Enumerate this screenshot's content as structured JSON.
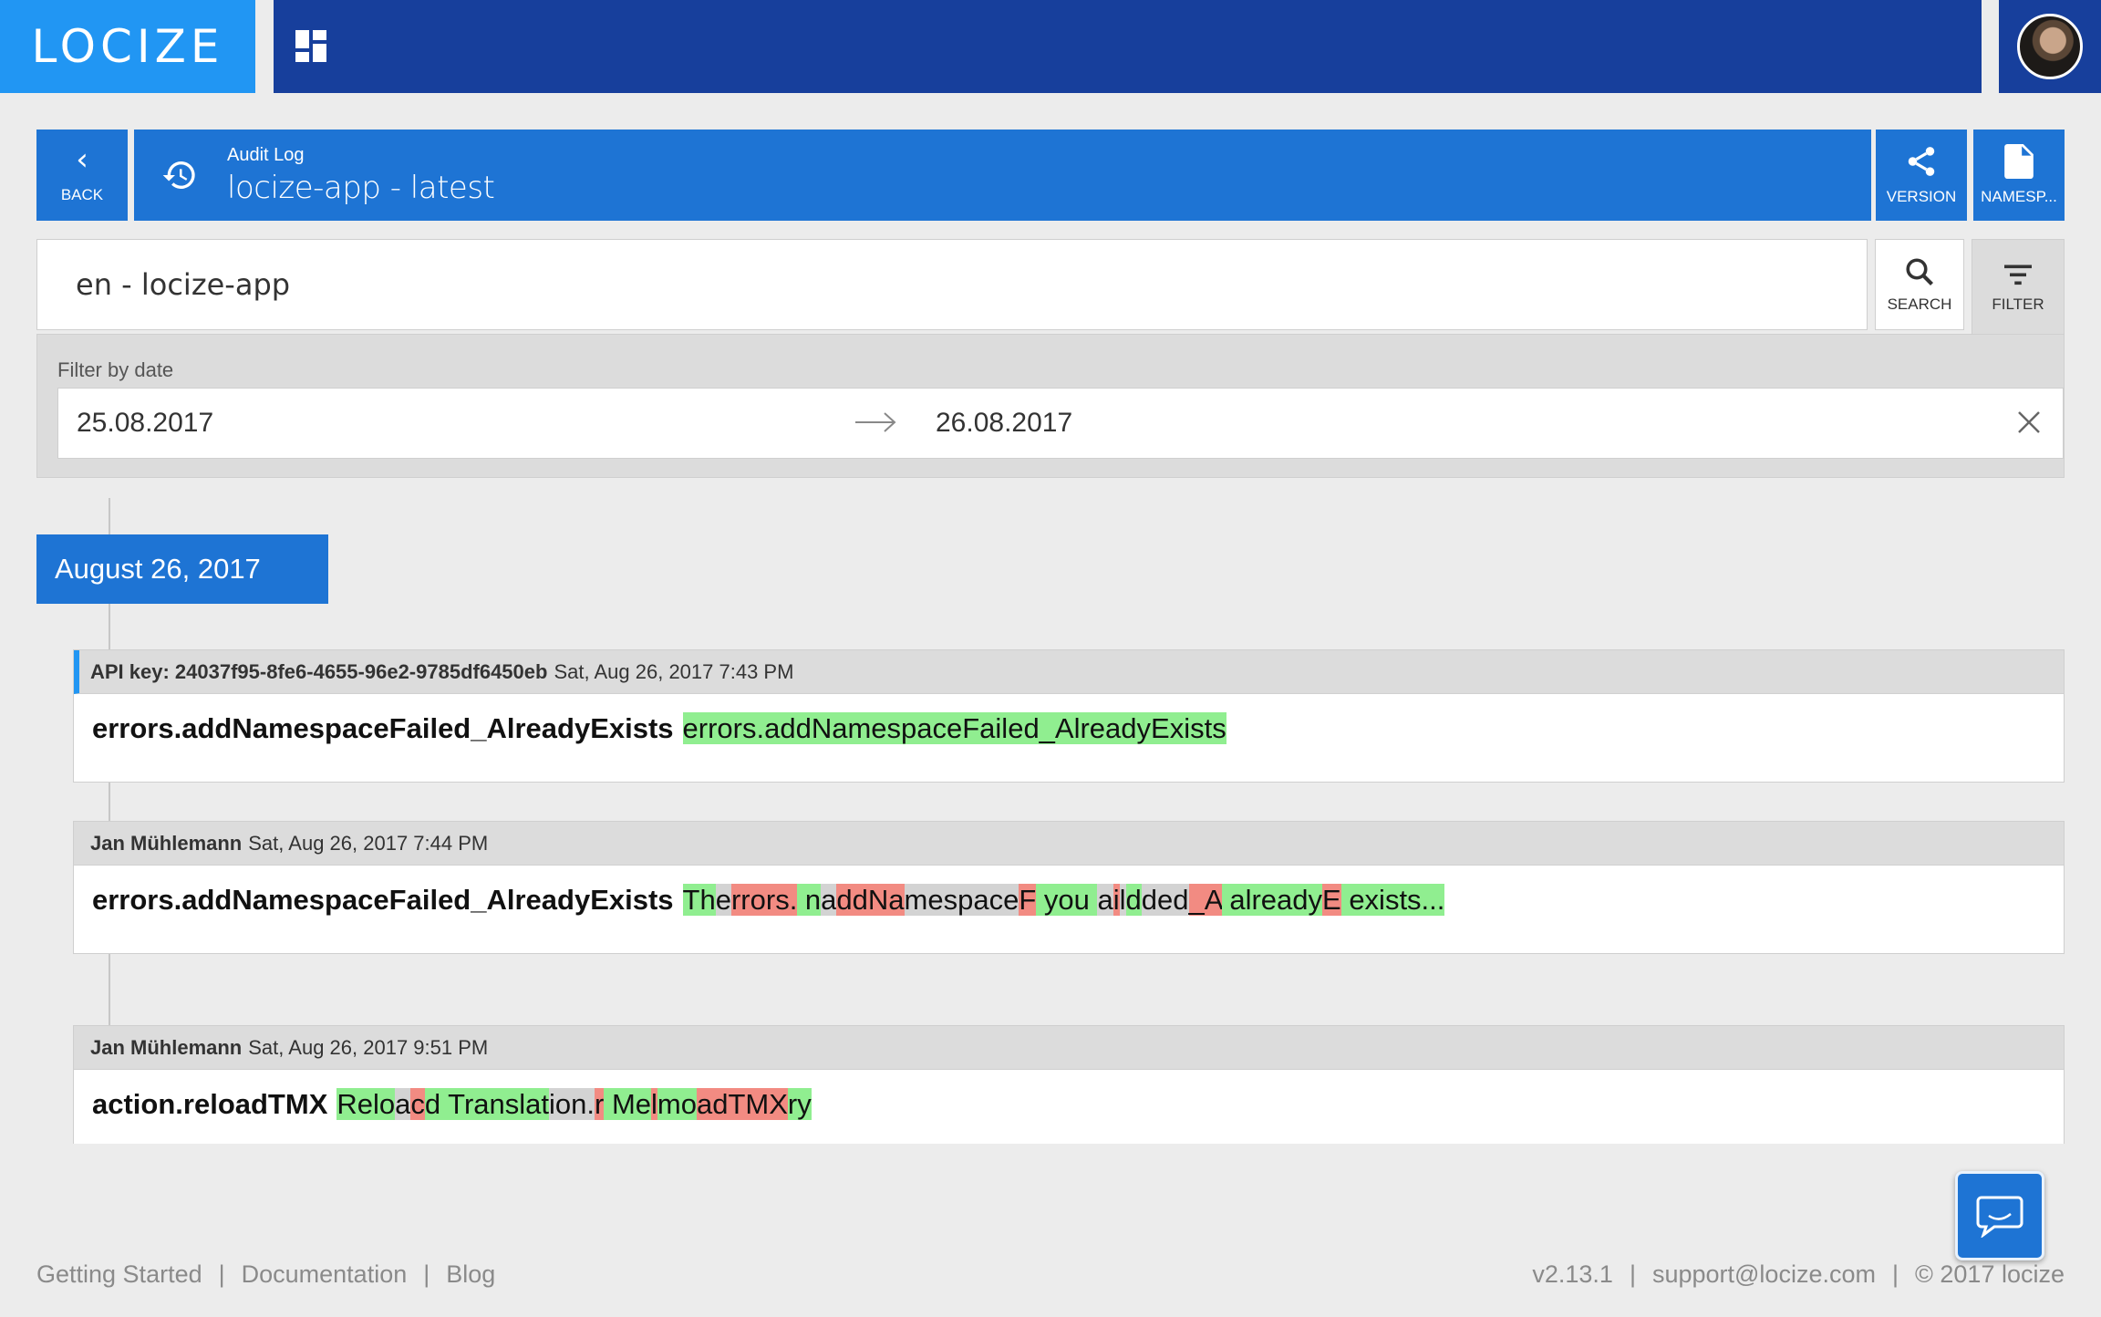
{
  "app": {
    "logo_text": "LOCIZE",
    "brand_color": "#2196f3",
    "nav_color": "#173f9c",
    "header_color": "#1e74d4"
  },
  "header": {
    "back_label": "BACK",
    "subtitle": "Audit Log",
    "title": "locize-app - latest",
    "version_label": "VERSION",
    "namespace_label": "NAMESP..."
  },
  "search": {
    "value": "en - locize-app",
    "search_label": "SEARCH",
    "filter_label": "FILTER"
  },
  "filter": {
    "label": "Filter by date",
    "date_from": "25.08.2017",
    "date_to": "26.08.2017"
  },
  "timeline": {
    "date_header": "August 26, 2017",
    "entries": [
      {
        "author": "API key: 24037f95-8fe6-4655-96e2-9785df6450eb",
        "timestamp": "Sat, Aug 26, 2017 7:43 PM",
        "key": "errors.addNamespaceFailed_AlreadyExists",
        "segments": [
          {
            "type": "add",
            "text": "errors.addNamespaceFailed_AlreadyExists"
          }
        ]
      },
      {
        "author": "Jan Mühlemann",
        "timestamp": "Sat, Aug 26, 2017 7:44 PM",
        "key": "errors.addNamespaceFailed_AlreadyExists",
        "segments": [
          {
            "type": "add",
            "text": "Th"
          },
          {
            "type": "same",
            "text": "e"
          },
          {
            "type": "del",
            "text": "rrors."
          },
          {
            "type": "add",
            "text": " n"
          },
          {
            "type": "same",
            "text": "a"
          },
          {
            "type": "del",
            "text": "ddNa"
          },
          {
            "type": "same",
            "text": "mespace"
          },
          {
            "type": "del",
            "text": "F"
          },
          {
            "type": "add",
            "text": " you "
          },
          {
            "type": "same",
            "text": "a"
          },
          {
            "type": "del",
            "text": "i"
          },
          {
            "type": "same",
            "text": "l"
          },
          {
            "type": "add",
            "text": "d"
          },
          {
            "type": "same",
            "text": "ded"
          },
          {
            "type": "del",
            "text": "_A"
          },
          {
            "type": "add",
            "text": " already"
          },
          {
            "type": "del",
            "text": "E"
          },
          {
            "type": "add",
            "text": " exists..."
          }
        ]
      },
      {
        "author": "Jan Mühlemann",
        "timestamp": "Sat, Aug 26, 2017 9:51 PM",
        "key": "action.reloadTMX",
        "segments": [
          {
            "type": "add",
            "text": "Relo"
          },
          {
            "type": "same",
            "text": "a"
          },
          {
            "type": "del",
            "text": "c"
          },
          {
            "type": "add",
            "text": "d Translat"
          },
          {
            "type": "same",
            "text": "ion."
          },
          {
            "type": "del",
            "text": "r"
          },
          {
            "type": "add",
            "text": " Me"
          },
          {
            "type": "del",
            "text": "l"
          },
          {
            "type": "add",
            "text": "mo"
          },
          {
            "type": "del",
            "text": "adTMX"
          },
          {
            "type": "add",
            "text": "ry"
          }
        ]
      }
    ]
  },
  "footer": {
    "getting_started": "Getting Started",
    "documentation": "Documentation",
    "blog": "Blog",
    "version": "v2.13.1",
    "support": "support@locize.com",
    "copyright": "© 2017 locize"
  }
}
